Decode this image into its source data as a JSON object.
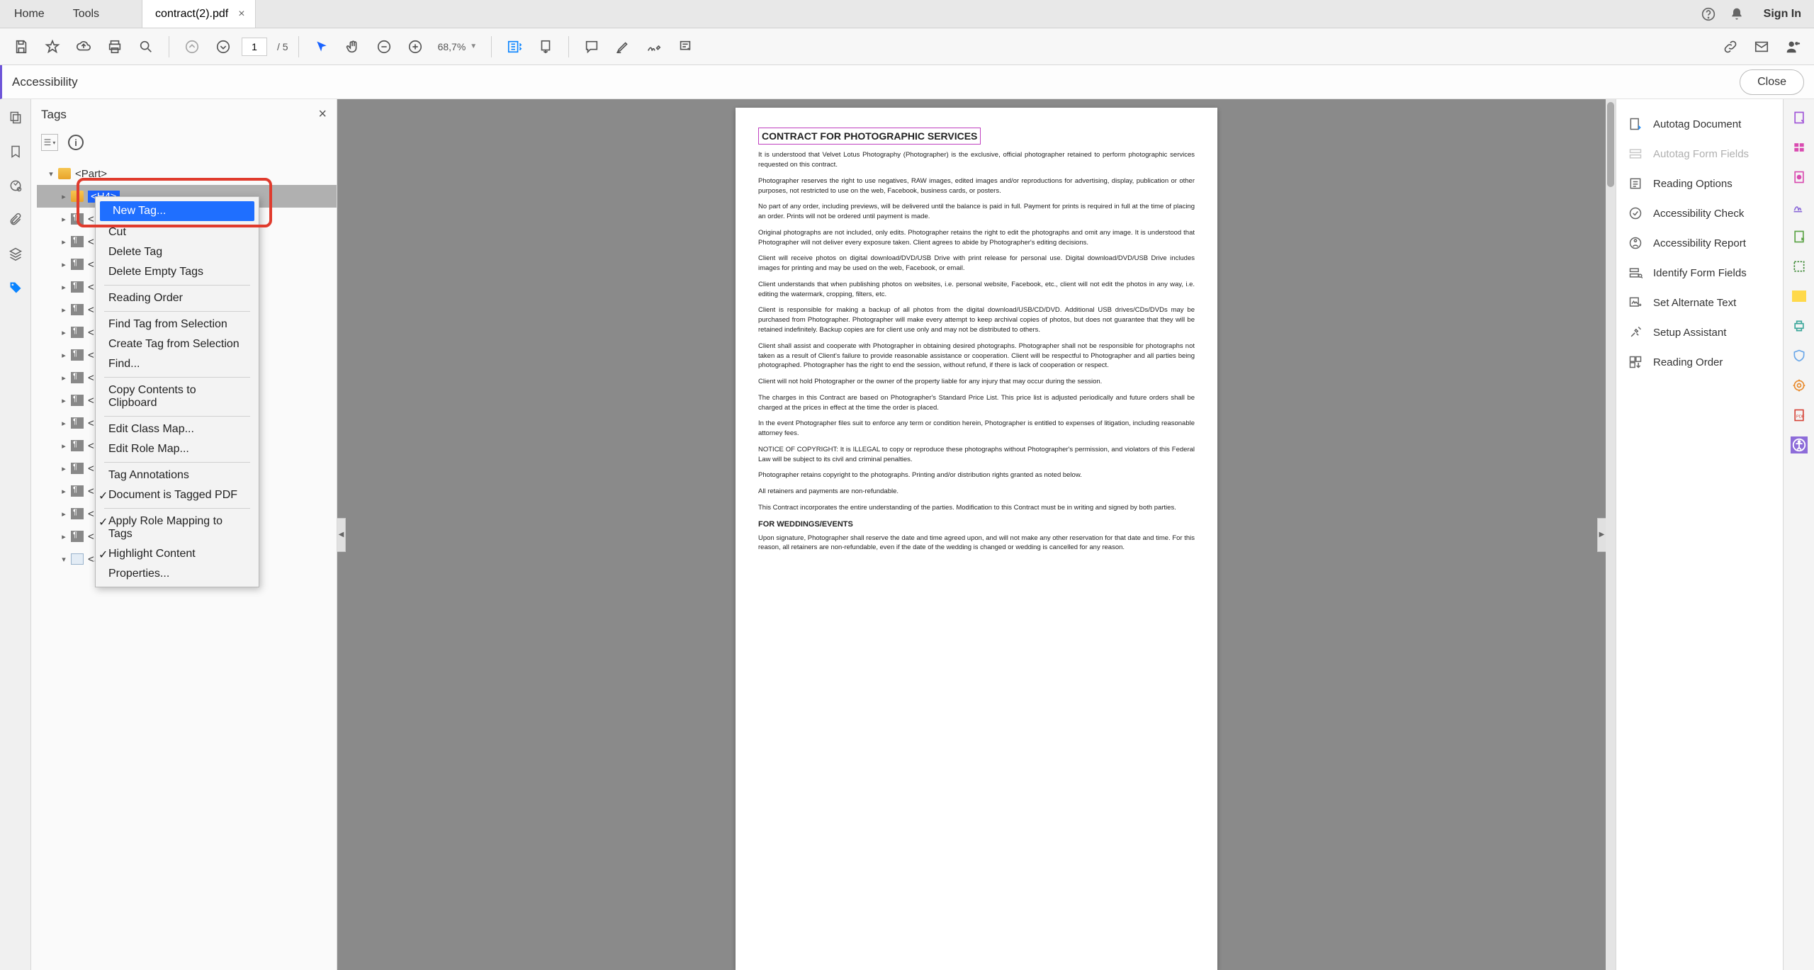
{
  "tabbar": {
    "home": "Home",
    "tools": "Tools",
    "doc_title": "contract(2).pdf",
    "signin": "Sign In"
  },
  "toolbar": {
    "page_current": "1",
    "page_total": "/  5",
    "zoom": "68,7%"
  },
  "acc_bar": {
    "title": "Accessibility",
    "close": "Close"
  },
  "tags_panel": {
    "title": "Tags",
    "tree": {
      "part": "<Part>",
      "h4": "<H4>",
      "p_label": "<P>",
      "p_hidden": "<P",
      "sect": "<Sect>"
    }
  },
  "context_menu": {
    "new_tag": "New Tag...",
    "cut": "Cut",
    "delete_tag": "Delete Tag",
    "delete_empty": "Delete Empty Tags",
    "reading_order": "Reading Order",
    "find_tag_sel": "Find Tag from Selection",
    "create_tag_sel": "Create Tag from Selection",
    "find": "Find...",
    "copy_clip": "Copy Contents to Clipboard",
    "edit_class": "Edit Class Map...",
    "edit_role": "Edit Role Map...",
    "tag_annot": "Tag Annotations",
    "doc_tagged": "Document is Tagged PDF",
    "apply_role": "Apply Role Mapping to Tags",
    "highlight": "Highlight Content",
    "properties": "Properties..."
  },
  "doc": {
    "title": "CONTRACT FOR PHOTOGRAPHIC SERVICES",
    "p1": "It is understood that Velvet Lotus Photography (Photographer) is the exclusive, official photographer retained to perform photographic services requested on this contract.",
    "p2": "Photographer reserves the right to use negatives, RAW images, edited images and/or reproductions for advertising, display, publication or other purposes, not restricted to use on the web, Facebook, business cards, or posters.",
    "p3": "No part of any order, including previews, will be delivered until the balance is paid in full. Payment for prints is required in full at the time of placing an order. Prints will not be ordered until payment is made.",
    "p4": "Original photographs are not included, only edits. Photographer retains the right to edit the photographs and omit any image. It is understood that Photographer will not deliver every exposure taken. Client agrees to abide by Photographer's editing decisions.",
    "p5": "Client will receive photos on digital download/DVD/USB Drive with print release for personal use. Digital download/DVD/USB Drive includes images for printing and may be used on the web, Facebook, or email.",
    "p6": "Client understands that when publishing photos on websites, i.e. personal website, Facebook, etc., client will not edit the photos in any way, i.e. editing the watermark, cropping, filters, etc.",
    "p7": "Client is responsible for making a backup of all photos from the digital download/USB/CD/DVD. Additional USB drives/CDs/DVDs may be purchased from Photographer. Photographer will make every attempt to keep archival copies of photos, but does not guarantee that they will be retained indefinitely. Backup copies are for client use only and may not be distributed to others.",
    "p8": "Client shall assist and cooperate with Photographer in obtaining desired photographs. Photographer shall not be responsible for photographs not taken as a result of Client's failure to provide reasonable assistance or cooperation. Client will be respectful to Photographer and all parties being photographed. Photographer has the right to end the session, without refund, if there is lack of cooperation or respect.",
    "p9": "Client will not hold Photographer or the owner of the property liable for any injury that may occur during the session.",
    "p10": "The charges in this Contract are based on Photographer's Standard Price List. This price list is adjusted periodically and future orders shall be charged at the prices in effect at the time the order is placed.",
    "p11": "In the event Photographer files suit to enforce any term or condition herein, Photographer is entitled to expenses of litigation, including reasonable attorney fees.",
    "p12": "NOTICE OF COPYRIGHT: It is ILLEGAL to copy or reproduce these photographs without Photographer's permission, and violators of this Federal Law will be subject to its civil and criminal penalties.",
    "p13": "Photographer retains copyright to the photographs. Printing and/or distribution rights granted as noted below.",
    "p14": "All retainers and payments are non-refundable.",
    "p15": "This Contract incorporates the entire understanding of the parties. Modification to this Contract must be in writing and signed by both parties.",
    "h2": "FOR WEDDINGS/EVENTS",
    "p16": "Upon signature, Photographer shall reserve the date and time agreed upon, and will not make any other reservation for that date and time. For this reason, all retainers are non-refundable, even if the date of the wedding is changed or wedding is cancelled for any reason."
  },
  "right_panel": {
    "autotag_doc": "Autotag Document",
    "autotag_form": "Autotag Form Fields",
    "reading_opts": "Reading Options",
    "acc_check": "Accessibility Check",
    "acc_report": "Accessibility Report",
    "identify_form": "Identify Form Fields",
    "alt_text": "Set Alternate Text",
    "setup_asst": "Setup Assistant",
    "reading_order": "Reading Order"
  }
}
